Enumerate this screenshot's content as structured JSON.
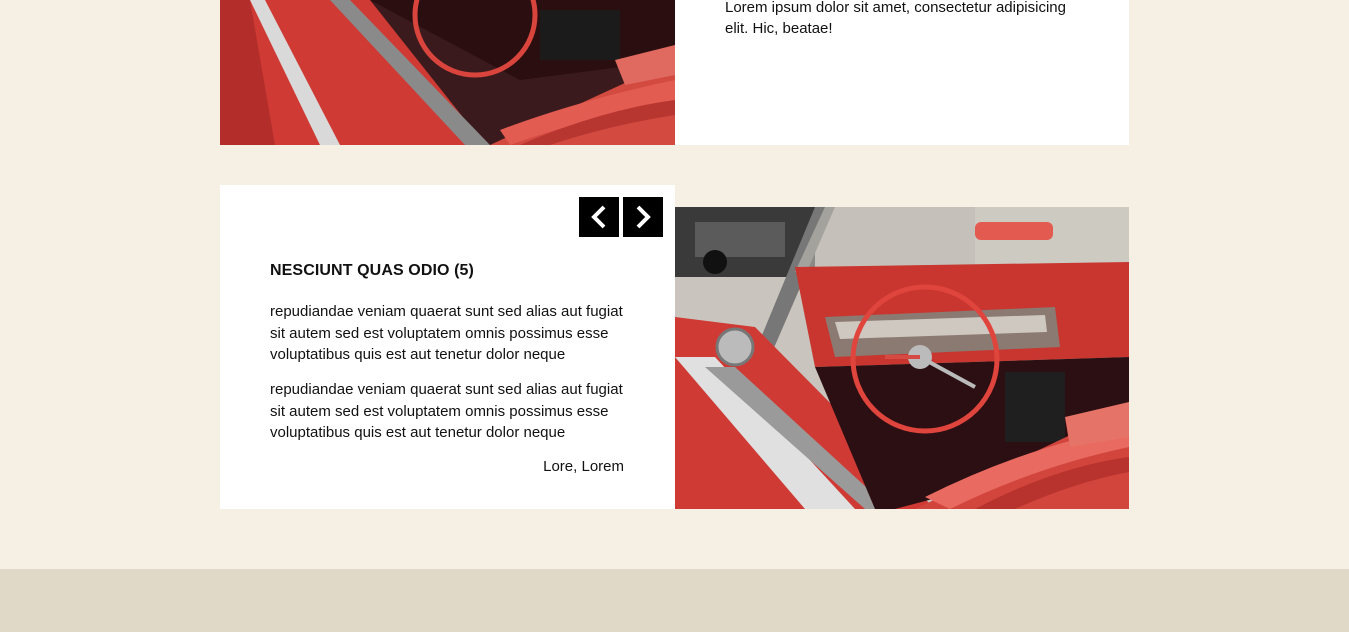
{
  "top_card": {
    "text": "Lorem ipsum dolor sit amet, consectetur adipisicing elit. Hic, beatae!",
    "image_label": "car-interior-photo"
  },
  "testimonial": {
    "title": "NESCIUNT QUAS ODIO (5)",
    "paragraphs": [
      "repudiandae veniam quaerat sunt sed alias aut fugiat sit autem sed est voluptatem omnis possimus esse voluptatibus quis est aut tenetur dolor neque",
      "repudiandae veniam quaerat sunt sed alias aut fugiat sit autem sed est voluptatem omnis possimus esse voluptatibus quis est aut tenetur dolor neque"
    ],
    "author": "Lore, Lorem",
    "prev_icon": "chevron-left-icon",
    "next_icon": "chevron-right-icon"
  },
  "colors": {
    "page_background": "#f5f0e3",
    "footer_background": "#e0d9c7",
    "card_background": "#ffffff",
    "button_background": "#000000",
    "car_red": "#d8403a"
  }
}
